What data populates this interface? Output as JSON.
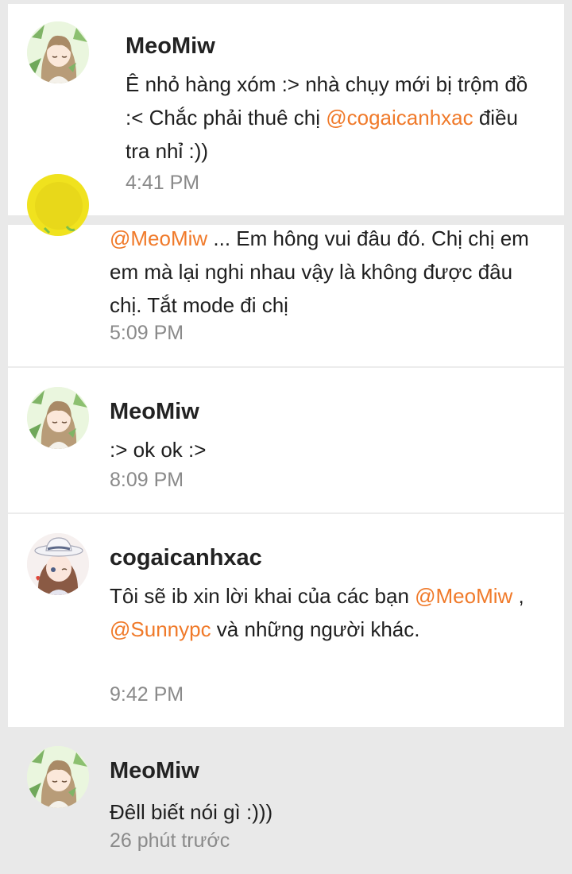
{
  "comments": [
    {
      "author": "MeoMiw",
      "text_parts": [
        "Ê nhỏ hàng xóm :> nhà chụy mới bị trộm đồ :< Chắc phải thuê chị ",
        "@cogaicanhxac",
        " điều tra nhỉ :))"
      ],
      "time": "4:41 PM",
      "avatar_icon": "anime-girl-green-avatar-icon"
    },
    {
      "author": "",
      "text_parts": [
        "@MeoMiw",
        "  ... Em hông vui đâu đó. Chị chị em em mà lại nghi nhau vậy là không được đâu chị. Tắt mode đi chị"
      ],
      "time": "5:09 PM",
      "avatar_icon": "yellow-avatar-icon"
    },
    {
      "author": "MeoMiw",
      "text_parts": [
        ":> ok ok :>"
      ],
      "time": "8:09 PM",
      "avatar_icon": "anime-girl-green-avatar-icon"
    },
    {
      "author": "cogaicanhxac",
      "text_parts": [
        "Tôi sẽ ib xin lời khai của các bạn ",
        "@MeoMiw",
        " ,  ",
        "@Sunnypc",
        " và những người khác."
      ],
      "time": "9:42 PM",
      "avatar_icon": "anime-girl-hat-avatar-icon"
    },
    {
      "author": "MeoMiw",
      "text_parts": [
        "Đêll biết nói gì :)))"
      ],
      "time": "26 phút trước",
      "avatar_icon": "anime-girl-green-avatar-icon"
    }
  ],
  "colors": {
    "mention": "#f07a2a",
    "background": "#e9e9e9",
    "card": "#ffffff",
    "time": "#8a8a8a"
  }
}
